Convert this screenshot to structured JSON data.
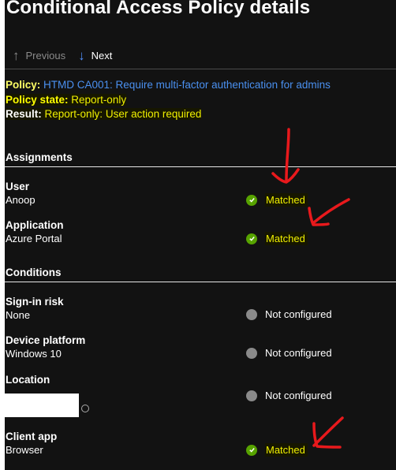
{
  "header": {
    "title": "Conditional Access Policy details"
  },
  "nav": {
    "previous_label": "Previous",
    "previous_icon": "arrow-up-icon",
    "next_label": "Next",
    "next_icon": "arrow-down-icon"
  },
  "summary": {
    "policy_label": "Policy:",
    "policy_value": "HTMD CA001: Require multi-factor authentication for admins",
    "state_label": "Policy state:",
    "state_value": "Report-only",
    "result_label": "Result:",
    "result_value": "Report-only: User action required"
  },
  "assignments": {
    "heading": "Assignments",
    "items": [
      {
        "label": "User",
        "value": "Anoop",
        "status": "Matched",
        "status_type": "matched"
      },
      {
        "label": "Application",
        "value": "Azure Portal",
        "status": "Matched",
        "status_type": "matched"
      }
    ]
  },
  "conditions": {
    "heading": "Conditions",
    "items": [
      {
        "label": "Sign-in risk",
        "value": "None",
        "status": "Not configured",
        "status_type": "not-configured"
      },
      {
        "label": "Device platform",
        "value": "Windows 10",
        "status": "Not configured",
        "status_type": "not-configured"
      },
      {
        "label": "Location",
        "value": "",
        "status": "Not configured",
        "status_type": "not-configured"
      },
      {
        "label": "Client app",
        "value": "Browser",
        "status": "Matched",
        "status_type": "matched"
      }
    ]
  },
  "colors": {
    "background": "#121212",
    "link": "#4a90f0",
    "highlight_text": "#f0f000",
    "matched": "#57a300",
    "not_configured": "#8a8a8a",
    "annotation": "#e8191c"
  }
}
